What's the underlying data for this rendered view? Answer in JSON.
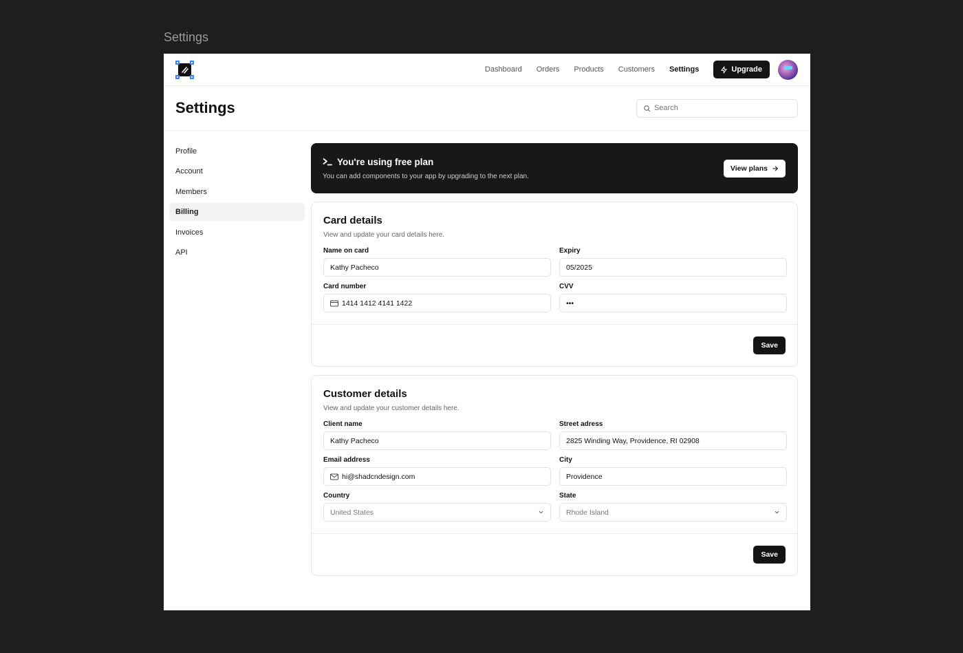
{
  "frame_label": "Settings",
  "nav": {
    "links": [
      "Dashboard",
      "Orders",
      "Products",
      "Customers",
      "Settings"
    ],
    "active": "Settings",
    "upgrade_label": "Upgrade"
  },
  "header": {
    "title": "Settings",
    "search_placeholder": "Search"
  },
  "sidebar": {
    "items": [
      "Profile",
      "Account",
      "Members",
      "Billing",
      "Invoices",
      "API"
    ],
    "active": "Billing"
  },
  "banner": {
    "title": "You're using free plan",
    "subtitle": "You can add components to your app by upgrading to the next plan.",
    "button_label": "View plans"
  },
  "card_details": {
    "title": "Card details",
    "subtitle": "View and update your card details here.",
    "name_label": "Name on card",
    "name_value": "Kathy Pacheco",
    "expiry_label": "Expiry",
    "expiry_value": "05/2025",
    "number_label": "Card number",
    "number_value": "1414 1412 4141 1422",
    "cvv_label": "CVV",
    "cvv_value": "•••",
    "save_label": "Save"
  },
  "customer_details": {
    "title": "Customer details",
    "subtitle": "View and update your customer details here.",
    "client_label": "Client name",
    "client_value": "Kathy Pacheco",
    "street_label": "Street adress",
    "street_value": "2825 Winding Way, Providence, RI 02908",
    "email_label": "Email address",
    "email_value": "hi@shadcndesign.com",
    "city_label": "City",
    "city_value": "Providence",
    "country_label": "Country",
    "country_value": "United States",
    "state_label": "State",
    "state_value": "Rhode Island",
    "save_label": "Save"
  },
  "colors": {
    "background": "#1e1e1e",
    "primary": "#141414",
    "logo_handle": "#3b82f6"
  }
}
